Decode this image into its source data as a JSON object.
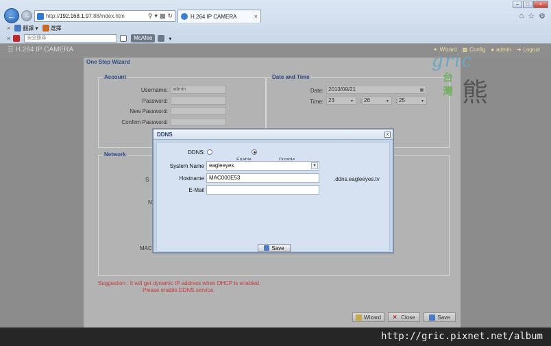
{
  "browser": {
    "url_prefix": "http://",
    "url_host": "192.168.1.97",
    "url_suffix": ":88/index.htm",
    "tab_title": "H.264 IP CAMERA",
    "toolbar1": {
      "item1": "翻譯",
      "item2": "選擇"
    },
    "toolbar2": {
      "search_placeholder": "安全搜尋",
      "mcafee": "McAfee"
    }
  },
  "app": {
    "title": "H.264 IP CAMERA",
    "nav": {
      "wizard": "Wizard",
      "config": "Config",
      "user": "admin",
      "logout": "Logout"
    }
  },
  "wizard": {
    "title": "One Step Wizard",
    "account": {
      "legend": "Account",
      "username_label": "Username:",
      "username_value": "admin",
      "password_label": "Password:",
      "new_password_label": "New Password:",
      "confirm_password_label": "Confirm Password:"
    },
    "datetime": {
      "legend": "Date and Time",
      "date_label": "Date:",
      "date_value": "2013/09/21",
      "time_label": "Time:",
      "hour": "23",
      "minute": "26",
      "second": "25"
    },
    "network": {
      "legend": "Network",
      "partial_label_1": "S",
      "partial_label_2": "N",
      "partial_label_mac": "MAC"
    },
    "suggestion_line1": "Suggestion : It will get dynamic IP address when DHCP is enabled.",
    "suggestion_line2": "Please enable DDNS service.",
    "buttons": {
      "wizard": "Wizard",
      "close": "Close",
      "save": "Save"
    }
  },
  "ddns_dialog": {
    "title": "DDNS",
    "close_glyph": "x",
    "ddns_label": "DDNS:",
    "ddns_enabled": true,
    "radio_enable_label": "Enable",
    "radio_disable_label": "Disable",
    "system_name_label": "System Name",
    "system_name_value": "eagleeyes",
    "hostname_label": "Hostname",
    "hostname_value": "MAC000E53",
    "hostname_suffix": ".ddns.eagleeyes.tv",
    "email_label": "E-Mail",
    "email_value": "",
    "save_label": "Save"
  },
  "watermark": {
    "logo_text": "gric",
    "logo_tw": "台灣",
    "logo_bear": "熊",
    "footer_url": "http://gric.pixnet.net/album"
  }
}
